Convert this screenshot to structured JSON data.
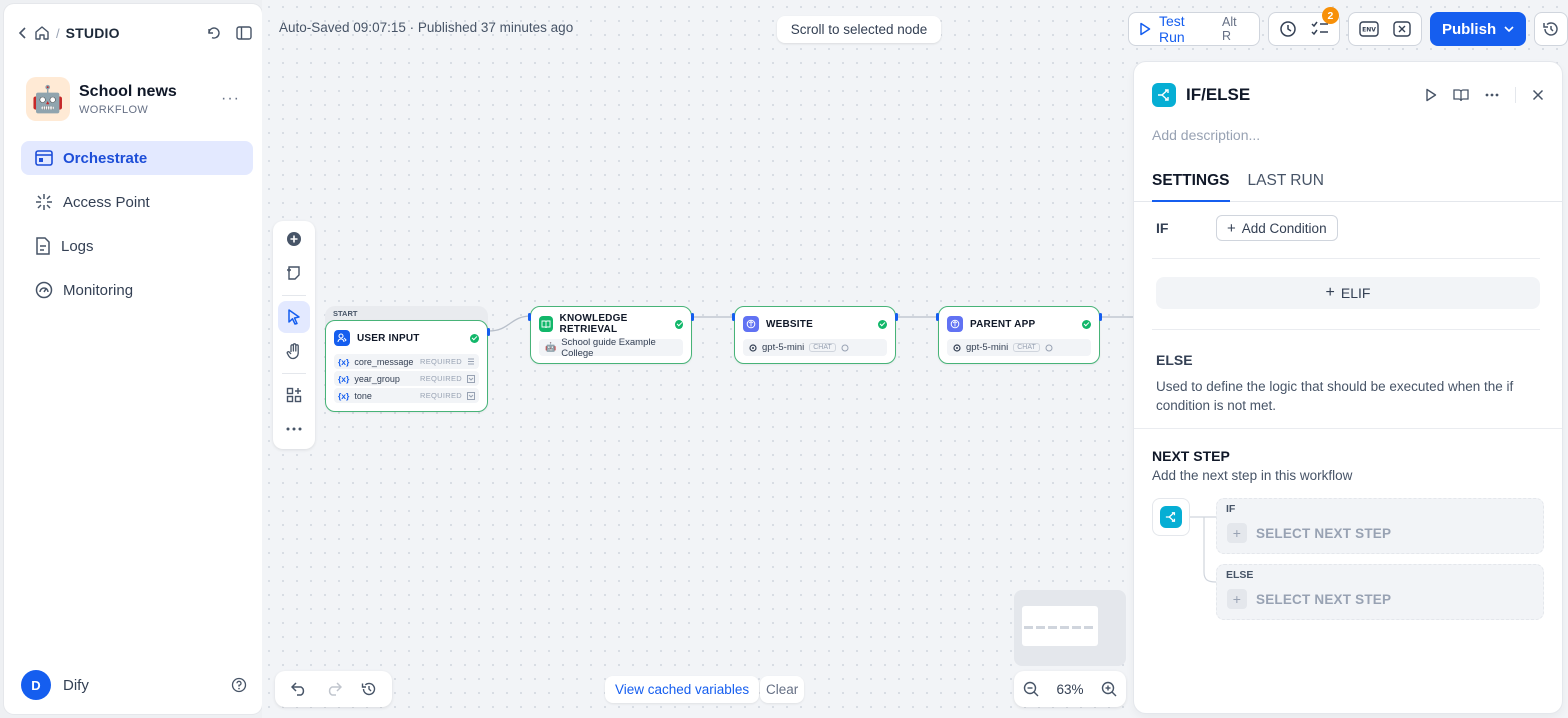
{
  "sidebar": {
    "breadcrumb": {
      "studio": "STUDIO",
      "sep": "/"
    },
    "app": {
      "name": "School news",
      "type": "WORKFLOW",
      "more": "···"
    },
    "nav": [
      {
        "label": "Orchestrate",
        "icon": "orchestrate-icon",
        "active": true
      },
      {
        "label": "Access Point",
        "icon": "access-point-icon"
      },
      {
        "label": "Logs",
        "icon": "logs-icon"
      },
      {
        "label": "Monitoring",
        "icon": "monitoring-icon"
      }
    ],
    "user": {
      "initial": "D",
      "name": "Dify"
    }
  },
  "header": {
    "autosave": "Auto-Saved 09:07:15 · Published 37 minutes ago",
    "scroll_to_selected": "Scroll to selected node",
    "test_run": {
      "label": "Test Run",
      "shortcut": "Alt  R"
    },
    "checklist_badge": "2",
    "publish": "Publish",
    "accent": "#155eef"
  },
  "canvas": {
    "start_label": "START",
    "nodes": {
      "user_input": {
        "title": "USER INPUT",
        "vars": [
          {
            "name": "core_message",
            "req": "REQUIRED"
          },
          {
            "name": "year_group",
            "req": "REQUIRED"
          },
          {
            "name": "tone",
            "req": "REQUIRED"
          }
        ]
      },
      "knowledge": {
        "title": "KNOWLEDGE RETRIEVAL",
        "dataset": "School guide Example College"
      },
      "website": {
        "title": "WEBSITE",
        "model": "gpt-5-mini",
        "tag": "CHAT"
      },
      "parent_app": {
        "title": "PARENT APP",
        "model": "gpt-5-mini",
        "tag": "CHAT"
      }
    },
    "var_prefix": "{x}",
    "cached_variables": "View cached variables",
    "clear": "Clear",
    "zoom": "63%"
  },
  "panel": {
    "title": "IF/ELSE",
    "description_placeholder": "Add description...",
    "tabs": [
      "SETTINGS",
      "LAST RUN"
    ],
    "if_label": "IF",
    "add_condition": "Add Condition",
    "elif": "ELIF",
    "else_title": "ELSE",
    "else_desc": "Used to define the logic that should be executed when the if condition is not met.",
    "next_step_title": "NEXT STEP",
    "next_step_desc": "Add the next step in this workflow",
    "branches": [
      {
        "label": "IF",
        "select": "SELECT NEXT STEP"
      },
      {
        "label": "ELSE",
        "select": "SELECT NEXT STEP"
      }
    ],
    "icon_color": "#06aed4"
  }
}
